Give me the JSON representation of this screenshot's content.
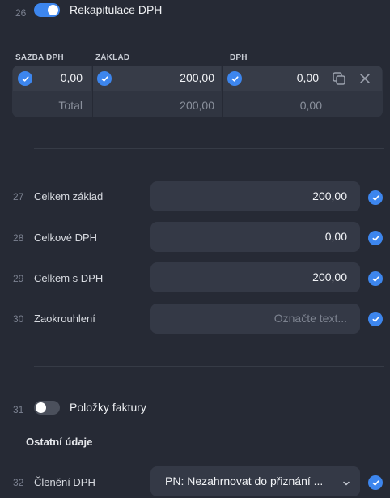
{
  "section_vat_recap": {
    "number": "26",
    "toggle_on": true,
    "title": "Rekapitulace DPH",
    "columns": {
      "rate": "SAZBA DPH",
      "base": "ZÁKLAD",
      "vat": "DPH"
    },
    "row": {
      "rate": "0,00",
      "base": "200,00",
      "vat": "0,00"
    },
    "total": {
      "label": "Total",
      "base": "200,00",
      "vat": "0,00"
    }
  },
  "fields": [
    {
      "number": "27",
      "label": "Celkem základ",
      "value": "200,00"
    },
    {
      "number": "28",
      "label": "Celkové DPH",
      "value": "0,00"
    },
    {
      "number": "29",
      "label": "Celkem s DPH",
      "value": "200,00"
    },
    {
      "number": "30",
      "label": "Zaokrouhlení",
      "placeholder": "Označte text..."
    }
  ],
  "section_items": {
    "number": "31",
    "toggle_on": false,
    "title": "Položky faktury"
  },
  "other_heading": "Ostatní údaje",
  "vat_split": {
    "number": "32",
    "label": "Členění DPH",
    "value": "PN: Nezahrnovat do přiznání ..."
  },
  "icons": {
    "check": "check-circle-icon",
    "copy": "copy-icon",
    "close": "close-icon",
    "chevron": "chevron-down-icon"
  },
  "colors": {
    "accent": "#3d86ee",
    "background": "#262a35",
    "field": "#343946"
  }
}
